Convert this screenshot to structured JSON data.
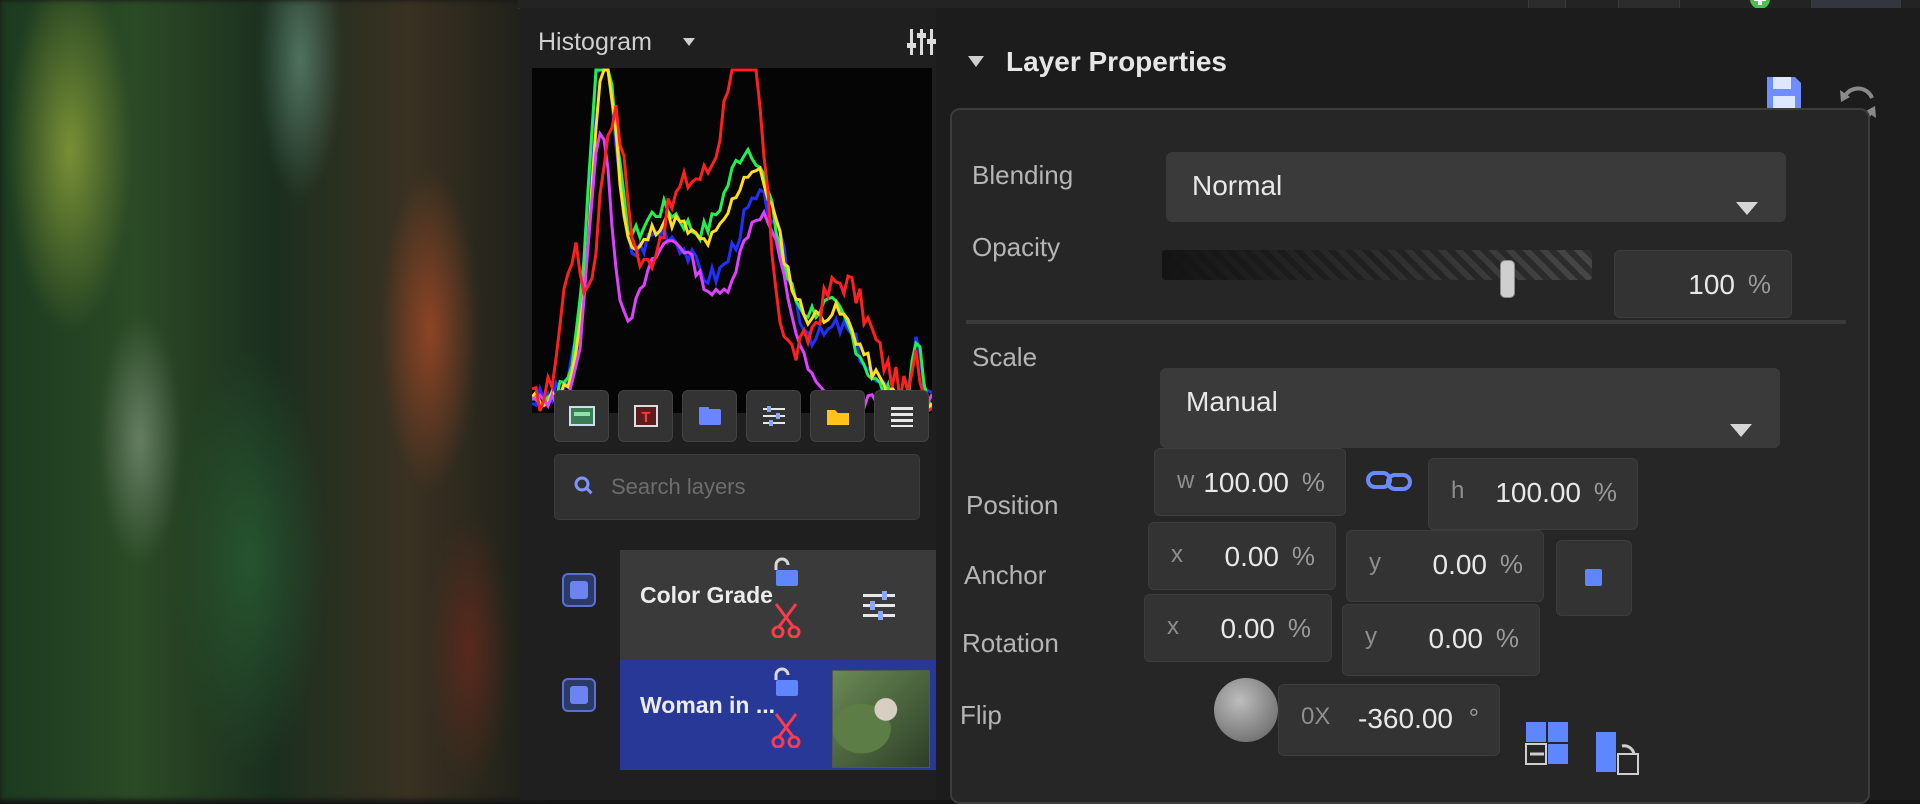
{
  "histogram": {
    "title": "Histogram",
    "colors": {
      "red": "#ff2020",
      "green": "#20f050",
      "blue": "#2030ff",
      "yellow": "#ffdd22",
      "magenta": "#e040ff"
    }
  },
  "layer_toolbar": {
    "icons": [
      "image-layer-icon",
      "text-layer-icon",
      "group-layer-icon",
      "adjustment-layer-icon",
      "folder-icon",
      "list-menu-icon"
    ]
  },
  "search": {
    "placeholder": "Search layers"
  },
  "layers": [
    {
      "name": "Color Grade",
      "selected": false
    },
    {
      "name": "Woman in ...",
      "selected": true
    }
  ],
  "properties": {
    "title": "Layer Properties",
    "blending": {
      "label": "Blending",
      "value": "Normal"
    },
    "opacity": {
      "label": "Opacity",
      "value": "100",
      "unit": "%",
      "level": 1.0
    },
    "scale": {
      "label": "Scale",
      "mode": "Manual",
      "w_label": "w",
      "w_value": "100.00",
      "w_unit": "%",
      "h_label": "h",
      "h_value": "100.00",
      "h_unit": "%"
    },
    "position": {
      "label": "Position",
      "x_label": "x",
      "x_value": "0.00",
      "x_unit": "%",
      "y_label": "y",
      "y_value": "0.00",
      "y_unit": "%"
    },
    "anchor": {
      "label": "Anchor",
      "x_label": "x",
      "x_value": "0.00",
      "x_unit": "%",
      "y_label": "y",
      "y_value": "0.00",
      "y_unit": "%"
    },
    "rotation": {
      "label": "Rotation",
      "prefix": "0X",
      "value": "-360.00",
      "unit": "°"
    },
    "flip": {
      "label": "Flip"
    }
  },
  "accent_color": "#5d86ff",
  "selected_row_color": "#273897"
}
